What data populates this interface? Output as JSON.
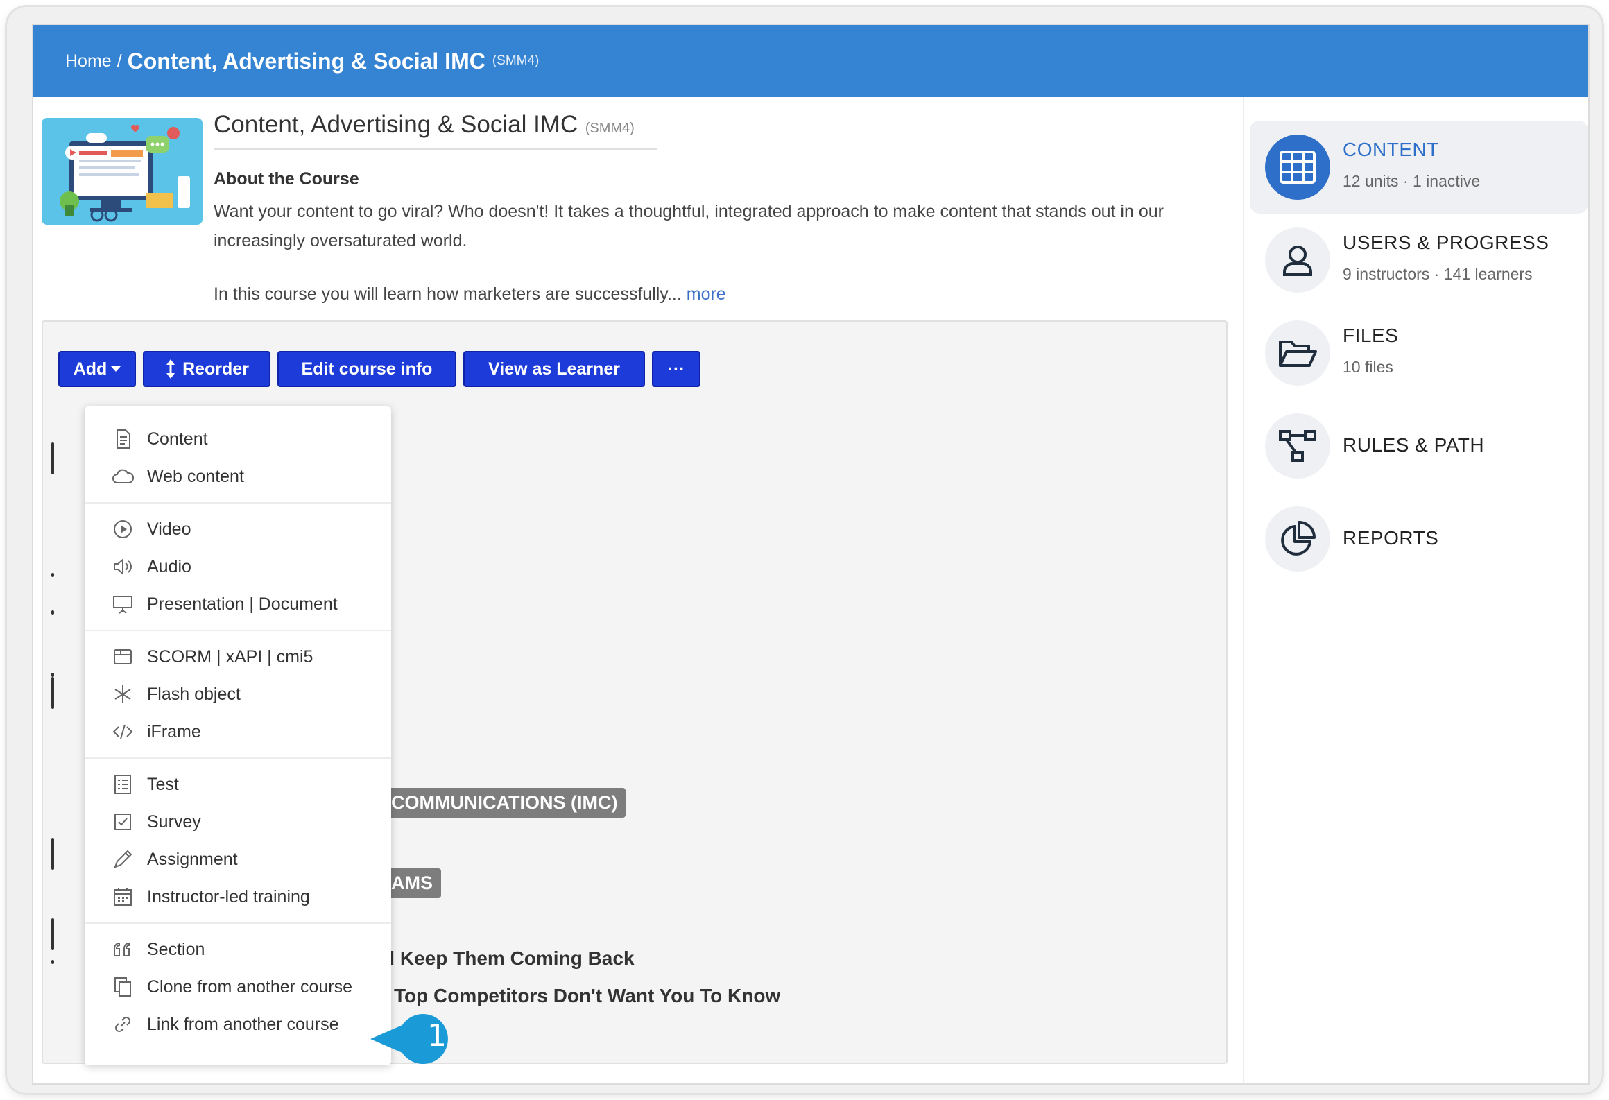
{
  "breadcrumb": {
    "home": "Home",
    "separator": "/",
    "course": "Content, Advertising & Social IMC",
    "code": "(SMM4)"
  },
  "course": {
    "title": "Content, Advertising & Social IMC",
    "code": "(SMM4)",
    "about_heading": "About the Course",
    "about_text": "Want your content to go viral? Who doesn't! It takes a thoughtful, integrated approach to make content that stands out in our increasingly oversaturated world.",
    "about_text2": "In this course you will learn how marketers are successfully...",
    "more_link": "more"
  },
  "toolbar": {
    "add_label": "Add",
    "reorder_label": "Reorder",
    "edit_label": "Edit course info",
    "view_label": "View as Learner",
    "more_label": "···"
  },
  "add_menu": {
    "groups": [
      [
        {
          "label": "Content",
          "icon": "document-icon"
        },
        {
          "label": "Web content",
          "icon": "cloud-icon"
        }
      ],
      [
        {
          "label": "Video",
          "icon": "play-icon"
        },
        {
          "label": "Audio",
          "icon": "speaker-icon"
        },
        {
          "label": "Presentation | Document",
          "icon": "presentation-icon"
        }
      ],
      [
        {
          "label": "SCORM | xAPI | cmi5",
          "icon": "package-icon"
        },
        {
          "label": "Flash object",
          "icon": "asterisk-icon"
        },
        {
          "label": "iFrame",
          "icon": "code-icon"
        }
      ],
      [
        {
          "label": "Test",
          "icon": "checklist-icon"
        },
        {
          "label": "Survey",
          "icon": "checkbox-icon"
        },
        {
          "label": "Assignment",
          "icon": "pencil-icon"
        },
        {
          "label": "Instructor-led training",
          "icon": "calendar-icon"
        }
      ],
      [
        {
          "label": "Section",
          "icon": "quote-icon"
        },
        {
          "label": "Clone from another course",
          "icon": "clone-icon"
        },
        {
          "label": "Link from another course",
          "icon": "link-icon"
        }
      ]
    ]
  },
  "background_units": {
    "tag1": "COMMUNICATIONS (IMC)",
    "tag2": "AMS",
    "unit1": "d Keep Them Coming Back",
    "unit2": "Top Competitors Don't Want You To Know"
  },
  "callout": {
    "number": "1",
    "color": "#1a9ad6"
  },
  "sidebar": {
    "items": [
      {
        "title": "CONTENT",
        "sub": "12 units · 1 inactive",
        "icon": "grid-icon",
        "active": true
      },
      {
        "title": "USERS & PROGRESS",
        "sub": "9 instructors · 141 learners",
        "icon": "user-icon"
      },
      {
        "title": "FILES",
        "sub": "10 files",
        "icon": "folder-icon"
      },
      {
        "title": "RULES & PATH",
        "sub": "",
        "icon": "path-icon"
      },
      {
        "title": "REPORTS",
        "sub": "",
        "icon": "pie-chart-icon"
      }
    ]
  },
  "colors": {
    "header": "#3584d4",
    "button": "#1d3bd8",
    "active": "#2d6fc9"
  }
}
